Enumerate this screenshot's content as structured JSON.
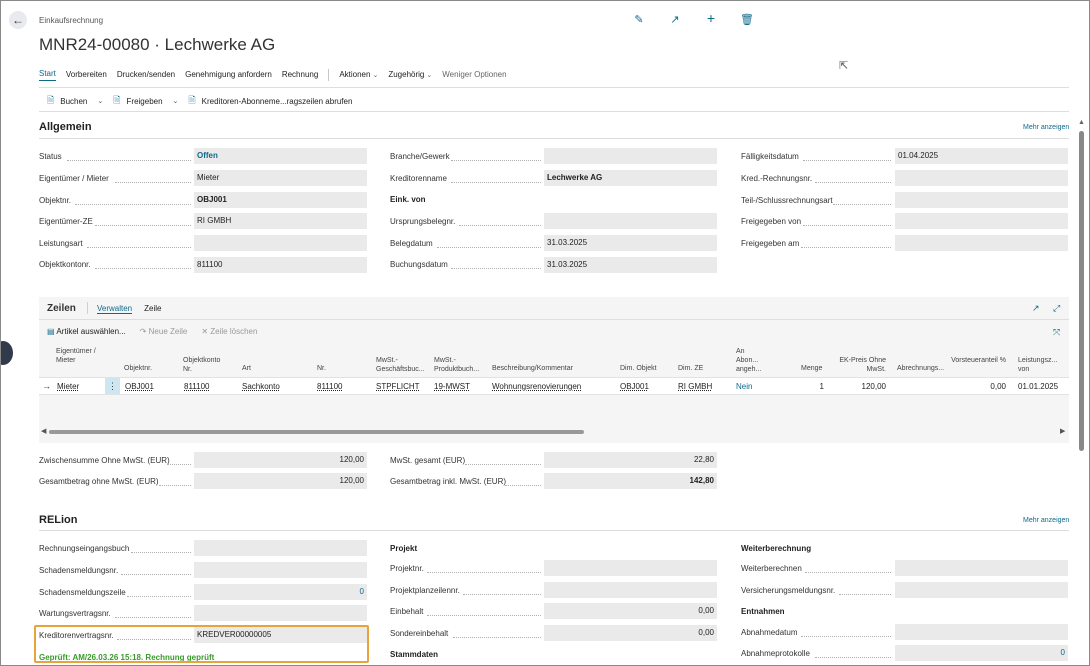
{
  "header": {
    "breadcrumb": "Einkaufsrechnung",
    "title": "MNR24-00080 · Lechwerke AG",
    "icons": [
      "edit-icon",
      "share-icon",
      "add-icon",
      "delete-icon"
    ]
  },
  "actionbar": {
    "items": [
      "Start",
      "Vorbereiten",
      "Drucken/senden",
      "Genehmigung anfordern",
      "Rechnung"
    ],
    "menus": [
      "Aktionen",
      "Zugehörig",
      "Weniger Optionen"
    ]
  },
  "toolbar": {
    "buchen": "Buchen",
    "freigeben": "Freigeben",
    "kreditoren": "Kreditoren-Abonneme...ragszeilen abrufen"
  },
  "allgemein": {
    "title": "Allgemein",
    "mehr": "Mehr anzeigen",
    "col1": [
      {
        "label": "Status",
        "value": "Offen"
      },
      {
        "label": "Eigentümer / Mieter",
        "value": "Mieter"
      },
      {
        "label": "Objektnr.",
        "value": "OBJ001"
      },
      {
        "label": "Eigentümer-ZE",
        "value": "RI GMBH"
      },
      {
        "label": "Leistungsart",
        "value": ""
      },
      {
        "label": "Objektkontonr.",
        "value": "811100"
      }
    ],
    "col2": [
      {
        "label": "Branche/Gewerk",
        "value": ""
      },
      {
        "label": "Kreditorenname",
        "value": "Lechwerke AG"
      },
      {
        "label": "Eink. von",
        "value": ""
      },
      {
        "label": "Ursprungsbelegnr.",
        "value": ""
      },
      {
        "label": "Belegdatum",
        "value": "31.03.2025"
      },
      {
        "label": "Buchungsdatum",
        "value": "31.03.2025"
      }
    ],
    "col3": [
      {
        "label": "Fälligkeitsdatum",
        "value": "01.04.2025"
      },
      {
        "label": "Kred.-Rechnungsnr.",
        "value": ""
      },
      {
        "label": "Teil-/Schlussrechnungsart",
        "value": ""
      },
      {
        "label": "Freigegeben von",
        "value": ""
      },
      {
        "label": "Freigegeben am",
        "value": ""
      }
    ]
  },
  "zeilen": {
    "title": "Zeilen",
    "tabs": [
      "Verwalten",
      "Zeile"
    ],
    "actions": {
      "artikel": "Artikel auswählen...",
      "neue": "Neue Zeile",
      "loeschen": "Zeile löschen"
    },
    "columns": [
      "Eigentümer / Mieter",
      "Objektnr.",
      "Objektkonto Nr.",
      "Art",
      "Nr.",
      "MwSt.-Geschäftsbuc...",
      "MwSt.-Produktbuch...",
      "Beschreibung/Kommentar",
      "Dim. Objekt",
      "Dim. ZE",
      "An Abon... angeh...",
      "Menge",
      "EK-Preis Ohne MwSt.",
      "Abrechnungs...",
      "Vorsteueranteil %",
      "Leistungsz... von"
    ],
    "row": {
      "eigentuemer": "Mieter",
      "objektnr": "OBJ001",
      "objektkonto": "811100",
      "art": "Sachkonto",
      "nr": "811100",
      "mwst_gesch": "STPFLICHT",
      "mwst_prod": "19-MWST",
      "beschreibung": "Wohnungsrenovierungen",
      "dim_objekt": "OBJ001",
      "dim_ze": "RI GMBH",
      "abon": "Nein",
      "menge": "1",
      "ek_preis": "120,00",
      "vorsteuer": "0,00",
      "leistung": "01.01.2025"
    }
  },
  "totals": {
    "zwischensumme_label": "Zwischensumme Ohne MwSt. (EUR)",
    "zwischensumme": "120,00",
    "gesamt_ohne_label": "Gesamtbetrag ohne MwSt. (EUR)",
    "gesamt_ohne": "120,00",
    "mwst_label": "MwSt. gesamt (EUR)",
    "mwst": "22,80",
    "gesamt_inkl_label": "Gesamtbetrag inkl. MwSt. (EUR)",
    "gesamt_inkl": "142,80"
  },
  "relion": {
    "title": "RELion",
    "mehr": "Mehr anzeigen",
    "col1": [
      {
        "label": "Rechnungseingangsbuch",
        "value": ""
      },
      {
        "label": "Schadensmeldungsnr.",
        "value": ""
      },
      {
        "label": "Schadensmeldungszeile",
        "value": "0"
      },
      {
        "label": "Wartungsvertragsnr.",
        "value": ""
      },
      {
        "label": "Kreditorenvertragsnr.",
        "value": "KREDVER00000005"
      }
    ],
    "geprueft": "Geprüft: AM/26.03.26 15:18. Rechnung geprüft",
    "projekt_head": "Projekt",
    "col2": [
      {
        "label": "Projektnr.",
        "value": ""
      },
      {
        "label": "Projektplanzeilennr.",
        "value": ""
      },
      {
        "label": "Einbehalt",
        "value": "0,00"
      },
      {
        "label": "Sondereinbehalt",
        "value": "0,00"
      }
    ],
    "stammdaten_head": "Stammdaten",
    "weiter_head": "Weiterberechnung",
    "col3a": [
      {
        "label": "Weiterberechnen",
        "value": ""
      },
      {
        "label": "Versicherungsmeldungsnr.",
        "value": ""
      }
    ],
    "entnahmen_head": "Entnahmen",
    "col3b": [
      {
        "label": "Abnahmedatum",
        "value": ""
      },
      {
        "label": "Abnahmeprotokolle",
        "value": "0"
      }
    ]
  }
}
